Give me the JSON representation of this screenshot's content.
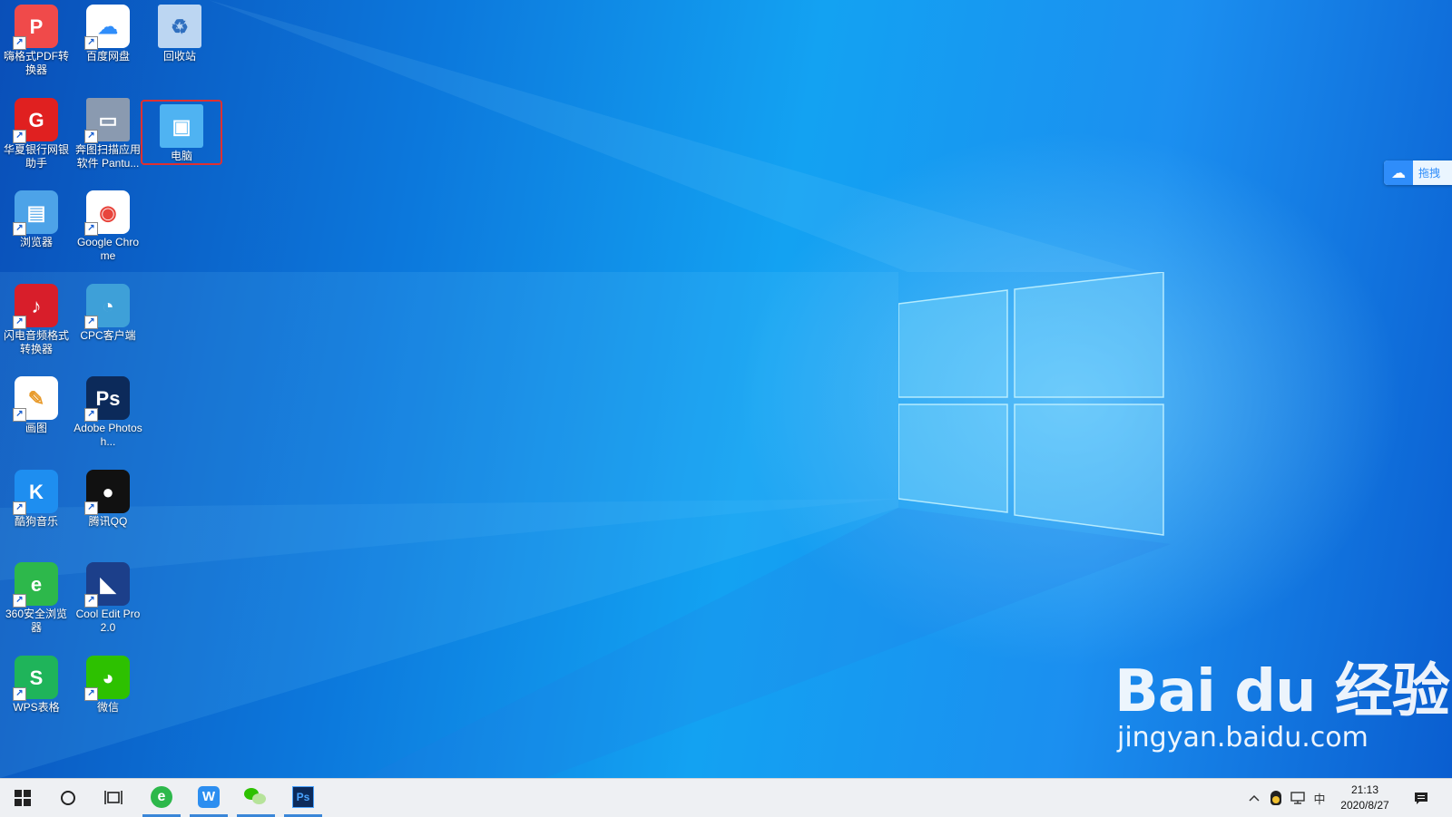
{
  "desktop": {
    "icons": [
      {
        "label": "嗨格式PDF转换器",
        "icon": "pdf-converter-icon",
        "color": "#f04a4a"
      },
      {
        "label": "百度网盘",
        "icon": "baidu-netdisk-icon",
        "color": "#ffffff"
      },
      {
        "label": "回收站",
        "icon": "recycle-bin-icon",
        "color": "#bcd6f2"
      },
      {
        "label": "华夏银行网银助手",
        "icon": "hxb-bank-icon",
        "color": "#e02020"
      },
      {
        "label": "奔图扫描应用软件 Pantu...",
        "icon": "scanner-icon",
        "color": "#8a9ab0"
      },
      {
        "label": "电脑",
        "icon": "this-pc-icon",
        "color": "#4fb3f2"
      },
      {
        "label": "浏览器",
        "icon": "browser-icon",
        "color": "#4da3e8"
      },
      {
        "label": "Google Chrome",
        "icon": "chrome-icon",
        "color": "#ffffff"
      },
      {
        "label": "闪电音频格式转换器",
        "icon": "audio-converter-icon",
        "color": "#d81e2a"
      },
      {
        "label": "CPC客户端",
        "icon": "cpc-client-icon",
        "color": "#3ea0d8"
      },
      {
        "label": "画图",
        "icon": "paint-icon",
        "color": "#ffffff"
      },
      {
        "label": "Adobe Photosh...",
        "icon": "photoshop-icon",
        "color": "#0c2a5a"
      },
      {
        "label": "酷狗音乐",
        "icon": "kugou-icon",
        "color": "#1e8ef0"
      },
      {
        "label": "腾讯QQ",
        "icon": "qq-icon",
        "color": "#111111"
      },
      {
        "label": "360安全浏览器",
        "icon": "browser-360-icon",
        "color": "#2db84b"
      },
      {
        "label": "Cool Edit Pro 2.0",
        "icon": "cool-edit-icon",
        "color": "#1c3f8a"
      },
      {
        "label": "WPS表格",
        "icon": "wps-sheet-icon",
        "color": "#1fb45a"
      },
      {
        "label": "微信",
        "icon": "wechat-icon",
        "color": "#2dc100"
      }
    ],
    "selected_icon": "电脑",
    "baidu_float": {
      "label": "拖拽"
    },
    "watermark": {
      "brand": "Bai du 经验",
      "site": "jingyan.baidu.com"
    }
  },
  "taskbar": {
    "start_icon": "windows-start-icon",
    "search_icon": "cortana-circle-icon",
    "taskview_icon": "task-view-icon",
    "pinned": [
      {
        "name": "browser-360-icon",
        "active": true
      },
      {
        "name": "wps-icon",
        "active": true
      },
      {
        "name": "wechat-icon",
        "active": true
      },
      {
        "name": "photoshop-icon",
        "active": true,
        "label": "Ps"
      }
    ],
    "tray": {
      "ime": "中",
      "time": "21:13",
      "date": "2020/8/27"
    }
  },
  "colors": {
    "accent": "#3a86d8",
    "selection": "#e03030"
  }
}
